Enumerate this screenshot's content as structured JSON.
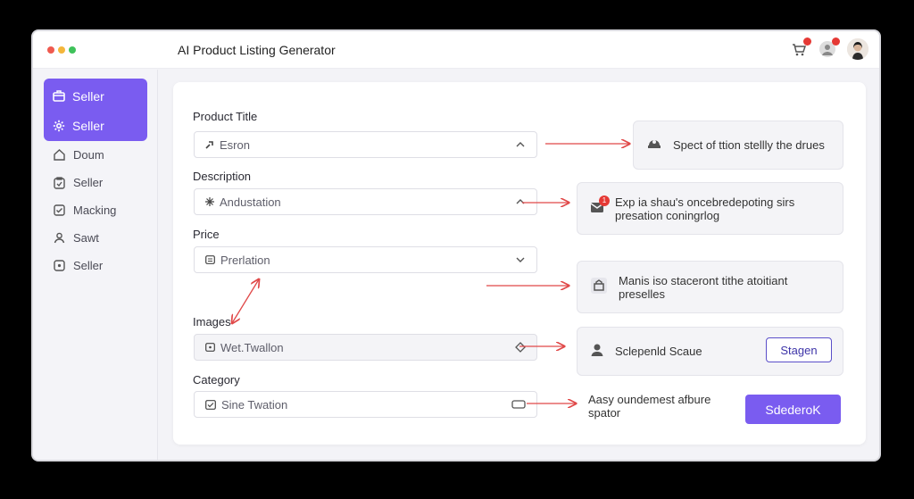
{
  "app": {
    "title": "AI Product Listing Generator"
  },
  "header": {
    "cart_icon": "cart-icon",
    "notification_icon": "user-bell-icon",
    "avatar": "avatar"
  },
  "sidebar": {
    "active_items": [
      {
        "label": "Seller",
        "icon": "box-icon"
      },
      {
        "label": "Seller",
        "icon": "gear-icon"
      }
    ],
    "items": [
      {
        "label": "Doum",
        "icon": "home-icon"
      },
      {
        "label": "Seller",
        "icon": "clipboard-icon"
      },
      {
        "label": "Macking",
        "icon": "check-square-icon"
      },
      {
        "label": "Sawt",
        "icon": "person-icon"
      },
      {
        "label": "Seller",
        "icon": "plus-square-icon"
      }
    ]
  },
  "form": {
    "product_title": {
      "label": "Product Title",
      "value": "Esron"
    },
    "description": {
      "label": "Description",
      "value": "Andustation"
    },
    "price": {
      "label": "Price",
      "value": "Prerlation"
    },
    "images": {
      "label": "Images",
      "value": "Wet.Twallon"
    },
    "category": {
      "label": "Category",
      "value": "Sine Twation"
    }
  },
  "suggestions": [
    {
      "text": "Spect of ttion stellly the drues"
    },
    {
      "text": "Exp ia shau's oncebredepoting sirs presation coningrlog",
      "badge": "1"
    },
    {
      "text": "Manis iso staceront tithe atoitiant preselles"
    },
    {
      "text": "Sclepenld Scaue",
      "button": "Stagen"
    }
  ],
  "note": {
    "text": "Aasy oundemest afbure spator"
  },
  "primary_button": {
    "label": "SdederoK"
  },
  "colors": {
    "accent": "#7a5cf0",
    "arrow": "#e04848",
    "button_outline": "#5b4fc9"
  }
}
